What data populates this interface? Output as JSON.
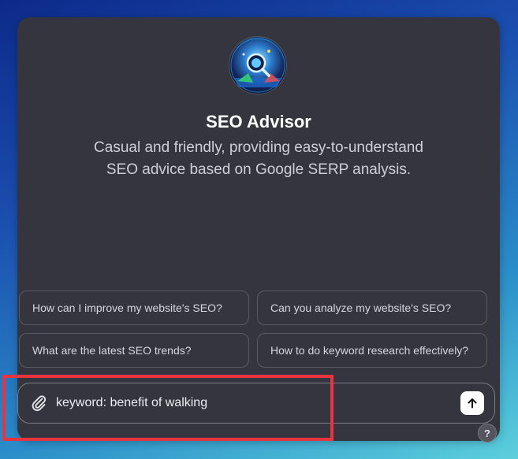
{
  "gpt": {
    "name": "SEO Advisor",
    "description_line1": "Casual and friendly, providing easy-to-understand",
    "description_line2": "SEO advice based on Google SERP analysis."
  },
  "suggestions": [
    "How can I improve my website's SEO?",
    "Can you analyze my website's SEO?",
    "What are the latest SEO trends?",
    "How to do keyword research effectively?"
  ],
  "composer": {
    "value": "keyword: benefit of walking",
    "attach_icon": "paperclip-icon",
    "send_icon": "arrow-up-icon"
  },
  "help": {
    "label": "?"
  },
  "colors": {
    "panel": "#35353f",
    "highlight": "#e8343f",
    "send_button": "#ffffff"
  }
}
